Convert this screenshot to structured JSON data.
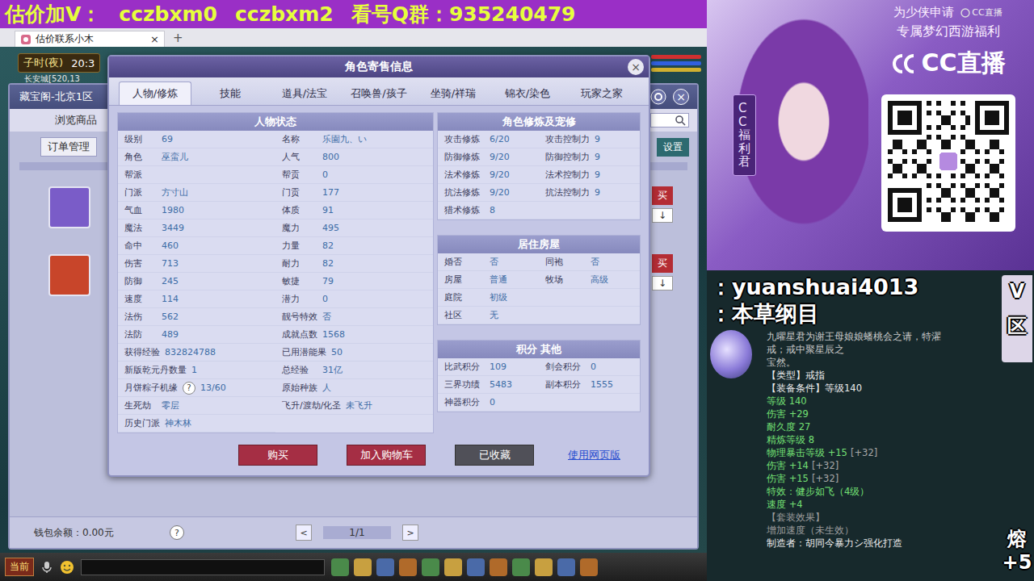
{
  "banner": {
    "segments": [
      "估价加V：",
      "cczbxm0",
      "cczbxm2",
      "看号Q群：935240479"
    ]
  },
  "browser": {
    "tab": "估价联系小木",
    "close": "×",
    "new_tab": "+"
  },
  "hud": {
    "time": "子时(夜)",
    "clock": "20:3",
    "location": "长安城[520,13"
  },
  "market_window": {
    "title": "藏宝阁-北京1区",
    "close": "×",
    "nav": "浏览商品",
    "orders_button": "订单管理",
    "settings": "设置",
    "listings": [
      {
        "avatar_color": "#7a5cc8",
        "buy": "买",
        "more": "↓"
      },
      {
        "avatar_color": "#c8452a",
        "buy": "买",
        "more": "↓"
      }
    ],
    "wallet": "钱包余额：0.00元",
    "help": "?",
    "pager": {
      "prev": "<",
      "page": "1/1",
      "next": ">"
    }
  },
  "dialog": {
    "title": "角色寄售信息",
    "close": "×",
    "tabs": [
      {
        "label": "人物/修炼",
        "selected": true
      },
      {
        "label": "技能",
        "selected": false
      },
      {
        "label": "道具/法宝",
        "selected": false
      },
      {
        "label": "召唤兽/孩子",
        "selected": false
      },
      {
        "label": "坐骑/祥瑞",
        "selected": false
      },
      {
        "label": "锦衣/染色",
        "selected": false
      },
      {
        "label": "玩家之家",
        "selected": false
      }
    ],
    "status": {
      "title": "人物状态",
      "left": [
        {
          "label": "级别",
          "value": "69"
        },
        {
          "label": "角色",
          "value": "巫蛮儿"
        },
        {
          "label": "帮派",
          "value": ""
        },
        {
          "label": "门派",
          "value": "方寸山"
        },
        {
          "label": "气血",
          "value": "1980"
        },
        {
          "label": "魔法",
          "value": "3449"
        },
        {
          "label": "命中",
          "value": "460"
        },
        {
          "label": "伤害",
          "value": "713"
        },
        {
          "label": "防御",
          "value": "245"
        },
        {
          "label": "速度",
          "value": "114"
        },
        {
          "label": "法伤",
          "value": "562"
        },
        {
          "label": "法防",
          "value": "489"
        },
        {
          "label": "获得经验",
          "value": "832824788"
        },
        {
          "label": "新版乾元丹数量",
          "value": "1"
        },
        {
          "label": "月饼粽子机缘",
          "value": "13/60",
          "badge": "?"
        },
        {
          "label": "生死劫",
          "value": "零层"
        },
        {
          "label": "历史门派",
          "value": "神木林"
        }
      ],
      "right": [
        {
          "label": "名称",
          "value": "乐園九、い"
        },
        {
          "label": "人气",
          "value": "800"
        },
        {
          "label": "帮贡",
          "value": "0"
        },
        {
          "label": "门贡",
          "value": "177"
        },
        {
          "label": "体质",
          "value": "91"
        },
        {
          "label": "魔力",
          "value": "495"
        },
        {
          "label": "力量",
          "value": "82"
        },
        {
          "label": "耐力",
          "value": "82"
        },
        {
          "label": "敏捷",
          "value": "79"
        },
        {
          "label": "潜力",
          "value": "0"
        },
        {
          "label": "靓号特效",
          "value": "否"
        },
        {
          "label": "成就点数",
          "value": "1568"
        },
        {
          "label": "已用潜能果",
          "value": "50"
        },
        {
          "label": "总经验",
          "value": "31亿"
        },
        {
          "label": "原始种族",
          "value": "人"
        },
        {
          "label": "飞升/渡劫/化圣",
          "value": "未飞升"
        }
      ]
    },
    "sections": [
      {
        "title": "角色修炼及宠修",
        "rows": [
          [
            {
              "label": "攻击修炼",
              "value": "6/20"
            },
            {
              "label": "攻击控制力",
              "value": "9"
            }
          ],
          [
            {
              "label": "防御修炼",
              "value": "9/20"
            },
            {
              "label": "防御控制力",
              "value": "9"
            }
          ],
          [
            {
              "label": "法术修炼",
              "value": "9/20"
            },
            {
              "label": "法术控制力",
              "value": "9"
            }
          ],
          [
            {
              "label": "抗法修炼",
              "value": "9/20"
            },
            {
              "label": "抗法控制力",
              "value": "9"
            }
          ],
          [
            {
              "label": "猎术修炼",
              "value": "8"
            }
          ]
        ]
      },
      {
        "title": "居住房屋",
        "rows": [
          [
            {
              "label": "婚否",
              "value": "否"
            },
            {
              "label": "同袍",
              "value": "否"
            }
          ],
          [
            {
              "label": "房屋",
              "value": "普通"
            },
            {
              "label": "牧场",
              "value": "高级"
            }
          ],
          [
            {
              "label": "庭院",
              "value": "初级"
            }
          ],
          [
            {
              "label": "社区",
              "value": "无"
            }
          ]
        ]
      },
      {
        "title": "积分 其他",
        "rows": [
          [
            {
              "label": "比武积分",
              "value": "109"
            },
            {
              "label": "剑会积分",
              "value": "0"
            }
          ],
          [
            {
              "label": "三界功绩",
              "value": "5483"
            },
            {
              "label": "副本积分",
              "value": "1555"
            }
          ],
          [
            {
              "label": "神器积分",
              "value": "0"
            }
          ]
        ]
      }
    ],
    "buttons": [
      {
        "label": "购买",
        "kind": "primary"
      },
      {
        "label": "加入购物车",
        "kind": "primary"
      },
      {
        "label": "已收藏",
        "kind": "muted"
      },
      {
        "label": "使用网页版",
        "kind": "link"
      }
    ]
  },
  "game_bar": {
    "channel": "当前"
  },
  "ad": {
    "headline1": "为少侠申请",
    "headline2": "专属梦幻西游福利",
    "watermark": "CC直播",
    "logo": "CC直播",
    "side_label": "CC福利君"
  },
  "overlay": {
    "lines": [
      "：yuanshuai4013",
      "：本草纲目"
    ]
  },
  "edge": {
    "top": [
      "V",
      "区"
    ],
    "bottom": [
      "熔",
      "+5"
    ]
  },
  "tooltip": {
    "desc": [
      "九曜星君为谢王母娘娘蟠桃会之请，特濯",
      "戒；戒中聚星辰之",
      "宝然。"
    ],
    "lines": [
      {
        "text": "【类型】戒指",
        "kind": "info"
      },
      {
        "text": "【装备条件】等级140",
        "kind": "info"
      },
      {
        "text": "等级 140",
        "kind": "attr"
      },
      {
        "text": "伤害 +29",
        "kind": "attr"
      },
      {
        "text": "耐久度 27",
        "kind": "attr"
      },
      {
        "text": "精炼等级 8",
        "kind": "attr"
      },
      {
        "text": "物理暴击等级 +15",
        "extra": "[+32]",
        "kind": "attr"
      },
      {
        "text": "伤害 +14",
        "extra": "[+32]",
        "kind": "attr"
      },
      {
        "text": "伤害 +15",
        "extra": "[+32]",
        "kind": "attr"
      },
      {
        "text": "特效：健步如飞（4级）",
        "kind": "effect"
      },
      {
        "text": "速度 +4",
        "kind": "attr"
      },
      {
        "text": "【套装效果】",
        "kind": "dim"
      },
      {
        "text": "增加速度（未生效）",
        "kind": "dim"
      },
      {
        "text": "制造者：胡同今暴力シ强化打造",
        "kind": "info"
      }
    ]
  }
}
